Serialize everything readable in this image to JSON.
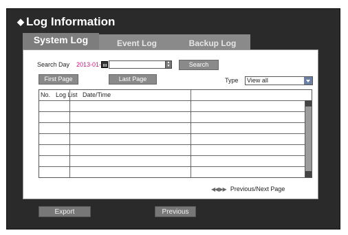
{
  "window": {
    "title": "Log Information"
  },
  "tabs": [
    {
      "label": "System Log",
      "active": true
    },
    {
      "label": "Event Log",
      "active": false
    },
    {
      "label": "Backup Log",
      "active": false
    }
  ],
  "search": {
    "label": "Search Day",
    "date_value": "2013-01-01",
    "button": "Search"
  },
  "paging": {
    "first": "First Page",
    "last": "Last Page",
    "prev_next": "Previous/Next Page"
  },
  "type_filter": {
    "label": "Type",
    "selected": "View all"
  },
  "table": {
    "columns": [
      "No.",
      "Log List",
      "Date/Time",
      ""
    ]
  },
  "footer": {
    "export": "Export",
    "previous": "Previous"
  },
  "colors": {
    "frame": "#2a2a2a",
    "tab_active": "#7d7d7d",
    "button": "#8a8a8a",
    "date_accent": "#c2187a"
  }
}
